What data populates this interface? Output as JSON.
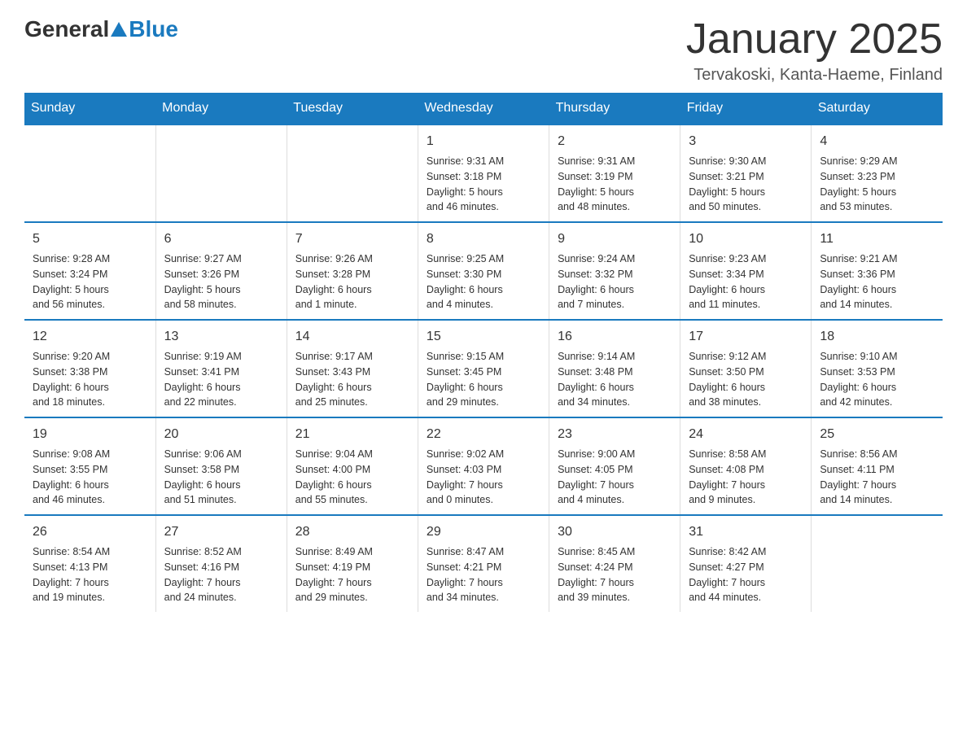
{
  "header": {
    "title": "January 2025",
    "location": "Tervakoski, Kanta-Haeme, Finland"
  },
  "logo": {
    "general": "General",
    "blue": "Blue"
  },
  "weekdays": [
    "Sunday",
    "Monday",
    "Tuesday",
    "Wednesday",
    "Thursday",
    "Friday",
    "Saturday"
  ],
  "weeks": [
    [
      {
        "day": "",
        "info": ""
      },
      {
        "day": "",
        "info": ""
      },
      {
        "day": "",
        "info": ""
      },
      {
        "day": "1",
        "info": "Sunrise: 9:31 AM\nSunset: 3:18 PM\nDaylight: 5 hours\nand 46 minutes."
      },
      {
        "day": "2",
        "info": "Sunrise: 9:31 AM\nSunset: 3:19 PM\nDaylight: 5 hours\nand 48 minutes."
      },
      {
        "day": "3",
        "info": "Sunrise: 9:30 AM\nSunset: 3:21 PM\nDaylight: 5 hours\nand 50 minutes."
      },
      {
        "day": "4",
        "info": "Sunrise: 9:29 AM\nSunset: 3:23 PM\nDaylight: 5 hours\nand 53 minutes."
      }
    ],
    [
      {
        "day": "5",
        "info": "Sunrise: 9:28 AM\nSunset: 3:24 PM\nDaylight: 5 hours\nand 56 minutes."
      },
      {
        "day": "6",
        "info": "Sunrise: 9:27 AM\nSunset: 3:26 PM\nDaylight: 5 hours\nand 58 minutes."
      },
      {
        "day": "7",
        "info": "Sunrise: 9:26 AM\nSunset: 3:28 PM\nDaylight: 6 hours\nand 1 minute."
      },
      {
        "day": "8",
        "info": "Sunrise: 9:25 AM\nSunset: 3:30 PM\nDaylight: 6 hours\nand 4 minutes."
      },
      {
        "day": "9",
        "info": "Sunrise: 9:24 AM\nSunset: 3:32 PM\nDaylight: 6 hours\nand 7 minutes."
      },
      {
        "day": "10",
        "info": "Sunrise: 9:23 AM\nSunset: 3:34 PM\nDaylight: 6 hours\nand 11 minutes."
      },
      {
        "day": "11",
        "info": "Sunrise: 9:21 AM\nSunset: 3:36 PM\nDaylight: 6 hours\nand 14 minutes."
      }
    ],
    [
      {
        "day": "12",
        "info": "Sunrise: 9:20 AM\nSunset: 3:38 PM\nDaylight: 6 hours\nand 18 minutes."
      },
      {
        "day": "13",
        "info": "Sunrise: 9:19 AM\nSunset: 3:41 PM\nDaylight: 6 hours\nand 22 minutes."
      },
      {
        "day": "14",
        "info": "Sunrise: 9:17 AM\nSunset: 3:43 PM\nDaylight: 6 hours\nand 25 minutes."
      },
      {
        "day": "15",
        "info": "Sunrise: 9:15 AM\nSunset: 3:45 PM\nDaylight: 6 hours\nand 29 minutes."
      },
      {
        "day": "16",
        "info": "Sunrise: 9:14 AM\nSunset: 3:48 PM\nDaylight: 6 hours\nand 34 minutes."
      },
      {
        "day": "17",
        "info": "Sunrise: 9:12 AM\nSunset: 3:50 PM\nDaylight: 6 hours\nand 38 minutes."
      },
      {
        "day": "18",
        "info": "Sunrise: 9:10 AM\nSunset: 3:53 PM\nDaylight: 6 hours\nand 42 minutes."
      }
    ],
    [
      {
        "day": "19",
        "info": "Sunrise: 9:08 AM\nSunset: 3:55 PM\nDaylight: 6 hours\nand 46 minutes."
      },
      {
        "day": "20",
        "info": "Sunrise: 9:06 AM\nSunset: 3:58 PM\nDaylight: 6 hours\nand 51 minutes."
      },
      {
        "day": "21",
        "info": "Sunrise: 9:04 AM\nSunset: 4:00 PM\nDaylight: 6 hours\nand 55 minutes."
      },
      {
        "day": "22",
        "info": "Sunrise: 9:02 AM\nSunset: 4:03 PM\nDaylight: 7 hours\nand 0 minutes."
      },
      {
        "day": "23",
        "info": "Sunrise: 9:00 AM\nSunset: 4:05 PM\nDaylight: 7 hours\nand 4 minutes."
      },
      {
        "day": "24",
        "info": "Sunrise: 8:58 AM\nSunset: 4:08 PM\nDaylight: 7 hours\nand 9 minutes."
      },
      {
        "day": "25",
        "info": "Sunrise: 8:56 AM\nSunset: 4:11 PM\nDaylight: 7 hours\nand 14 minutes."
      }
    ],
    [
      {
        "day": "26",
        "info": "Sunrise: 8:54 AM\nSunset: 4:13 PM\nDaylight: 7 hours\nand 19 minutes."
      },
      {
        "day": "27",
        "info": "Sunrise: 8:52 AM\nSunset: 4:16 PM\nDaylight: 7 hours\nand 24 minutes."
      },
      {
        "day": "28",
        "info": "Sunrise: 8:49 AM\nSunset: 4:19 PM\nDaylight: 7 hours\nand 29 minutes."
      },
      {
        "day": "29",
        "info": "Sunrise: 8:47 AM\nSunset: 4:21 PM\nDaylight: 7 hours\nand 34 minutes."
      },
      {
        "day": "30",
        "info": "Sunrise: 8:45 AM\nSunset: 4:24 PM\nDaylight: 7 hours\nand 39 minutes."
      },
      {
        "day": "31",
        "info": "Sunrise: 8:42 AM\nSunset: 4:27 PM\nDaylight: 7 hours\nand 44 minutes."
      },
      {
        "day": "",
        "info": ""
      }
    ]
  ]
}
